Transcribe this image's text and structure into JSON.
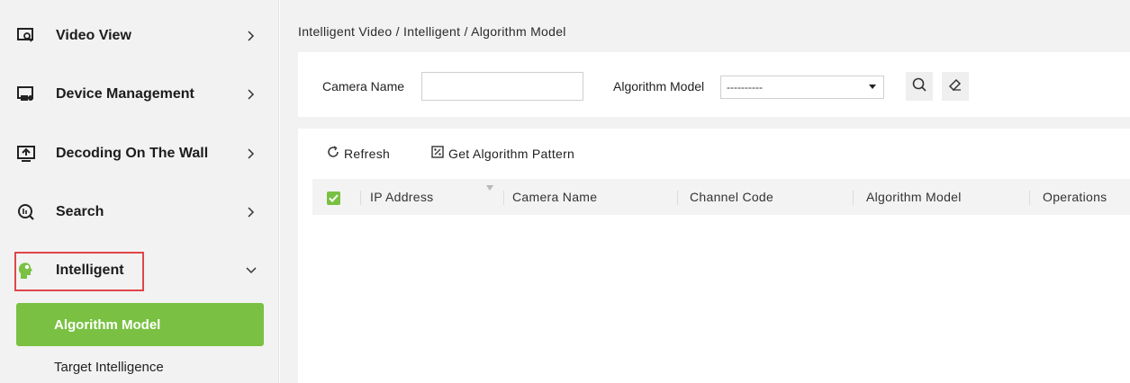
{
  "sidebar": {
    "items": [
      {
        "label": "Video View",
        "icon": "video-view-icon"
      },
      {
        "label": "Device Management",
        "icon": "device-management-icon"
      },
      {
        "label": "Decoding On The Wall",
        "icon": "decoding-wall-icon"
      },
      {
        "label": "Search",
        "icon": "search-icon"
      },
      {
        "label": "Intelligent",
        "icon": "intelligent-icon",
        "expanded": true
      }
    ],
    "subitems": [
      {
        "label": "Algorithm Model",
        "active": true
      },
      {
        "label": "Target Intelligence",
        "active": false
      }
    ]
  },
  "breadcrumb": "Intelligent Video / Intelligent / Algorithm Model",
  "filter": {
    "camera_name_label": "Camera Name",
    "camera_name_value": "",
    "algorithm_model_label": "Algorithm Model",
    "algorithm_model_value": "----------"
  },
  "toolbar": {
    "refresh_label": "Refresh",
    "get_pattern_label": "Get Algorithm Pattern"
  },
  "table": {
    "select_all_checked": true,
    "columns": [
      "IP Address",
      "Camera Name",
      "Channel Code",
      "Algorithm Model",
      "Operations"
    ],
    "rows": []
  },
  "colors": {
    "accent": "#7ac143",
    "highlight_border": "#e0454a",
    "background": "#f2f2f2"
  }
}
